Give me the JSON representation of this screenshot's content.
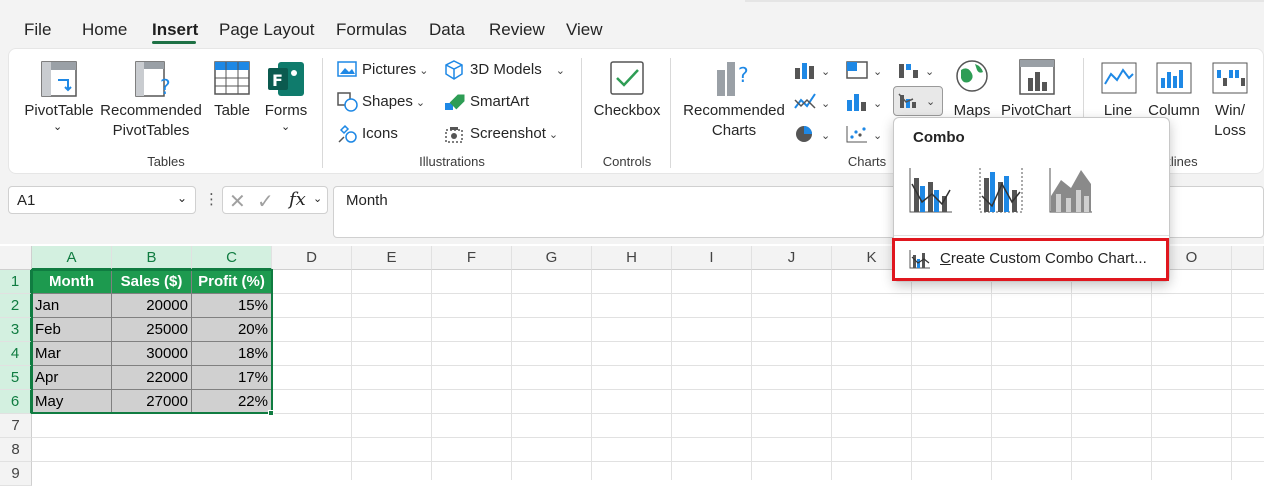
{
  "menu": {
    "tabs": [
      "File",
      "Home",
      "Insert",
      "Page Layout",
      "Formulas",
      "Data",
      "Review",
      "View"
    ],
    "active": "Insert"
  },
  "ribbon": {
    "tables": {
      "pivottable": "PivotTable",
      "recommended_pivot_1": "Recommended",
      "recommended_pivot_2": "PivotTables",
      "table": "Table",
      "forms": "Forms",
      "group_label": "Tables"
    },
    "illustrations": {
      "pictures": "Pictures",
      "shapes": "Shapes",
      "icons": "Icons",
      "models3d": "3D Models",
      "smartart": "SmartArt",
      "screenshot": "Screenshot",
      "group_label": "Illustrations"
    },
    "controls": {
      "checkbox": "Checkbox",
      "group_label": "Controls"
    },
    "charts": {
      "recommended_1": "Recommended",
      "recommended_2": "Charts",
      "maps": "Maps",
      "pivotchart": "PivotChart",
      "group_label": "Charts"
    },
    "sparklines": {
      "line": "Line",
      "column": "Column",
      "winloss_1": "Win/",
      "winloss_2": "Loss",
      "group_label_partial": "rklines"
    }
  },
  "formula_bar": {
    "name_box": "A1",
    "fx": "fx",
    "content": "Month"
  },
  "grid": {
    "columns": [
      "A",
      "B",
      "C",
      "D",
      "E",
      "F",
      "G",
      "H",
      "I",
      "J",
      "K",
      "",
      "",
      "",
      "O"
    ],
    "rows": [
      "1",
      "2",
      "3",
      "4",
      "5",
      "6",
      "7",
      "8",
      "9"
    ],
    "header": [
      "Month",
      "Sales ($)",
      "Profit (%)"
    ],
    "data": [
      [
        "Jan",
        "20000",
        "15%"
      ],
      [
        "Feb",
        "25000",
        "20%"
      ],
      [
        "Mar",
        "30000",
        "18%"
      ],
      [
        "Apr",
        "22000",
        "17%"
      ],
      [
        "May",
        "27000",
        "22%"
      ]
    ]
  },
  "combo_dropdown": {
    "title": "Combo",
    "custom_label": "Create Custom Combo Chart...",
    "custom_mnemonic": "C",
    "custom_rest": "reate Custom Combo Chart..."
  },
  "colors": {
    "accent": "#107c41",
    "header_fill": "#1d9a4f",
    "highlight": "#e0161e"
  }
}
